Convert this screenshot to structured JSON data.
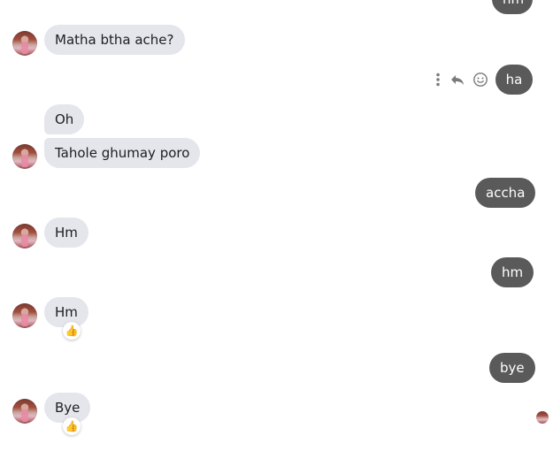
{
  "messages": {
    "partial_top": "hm",
    "m1": "Matha btha ache?",
    "m2": "ha",
    "m3": "Oh",
    "m4": "Tahole ghumay poro",
    "m5": "accha",
    "m6": "Hm",
    "m7": "hm",
    "m8": "Hm",
    "m9": "bye",
    "m10": "Bye"
  },
  "reactions": {
    "r1": "👍",
    "r2": "👍"
  },
  "icons": {
    "more": "more-vertical-icon",
    "reply": "reply-icon",
    "react": "emoji-smile-icon"
  },
  "colors": {
    "incoming_bubble": "#e4e6eb",
    "outgoing_bubble": "#5a5a5a"
  }
}
